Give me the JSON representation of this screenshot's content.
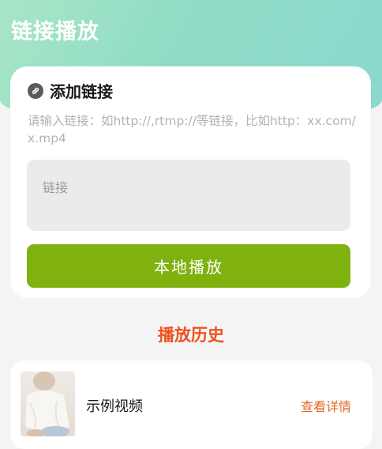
{
  "header": {
    "title": "链接播放"
  },
  "add_link": {
    "icon": "link-icon",
    "title": "添加链接",
    "hint": "请输入链接：如http://,rtmp://等链接，比如http：xx.com/x.mp4",
    "input": {
      "placeholder": "链接",
      "value": ""
    },
    "play_button": "本地播放"
  },
  "history": {
    "title": "播放历史",
    "items": [
      {
        "name": "示例视频",
        "action": "查看详情"
      }
    ]
  },
  "colors": {
    "accent_green": "#7fb10f",
    "history_orange": "#f0501e",
    "detail_orange": "#e26a23"
  }
}
